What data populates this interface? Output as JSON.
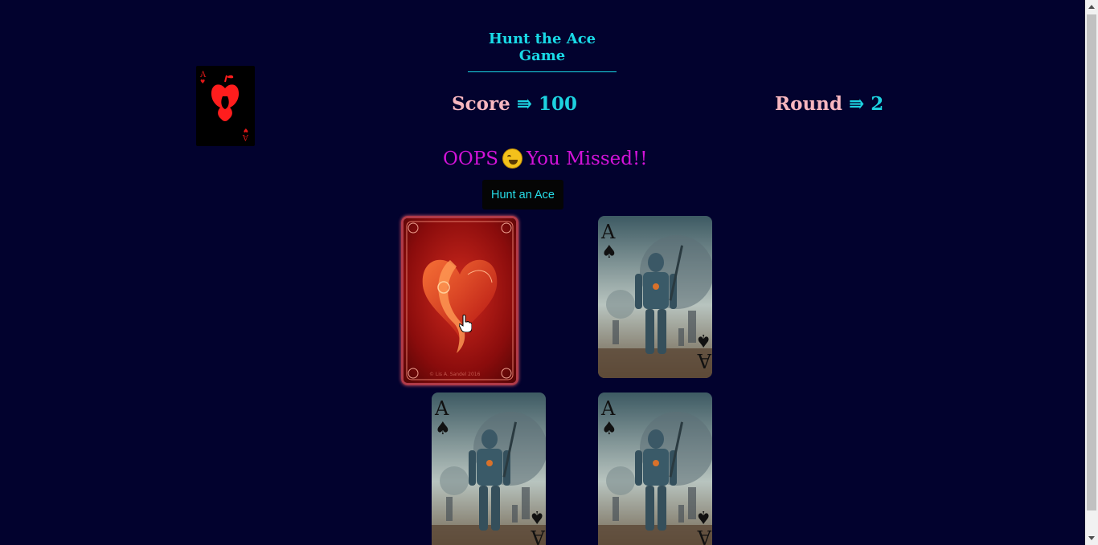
{
  "game": {
    "title": "Hunt the Ace Game",
    "score_label": "Score",
    "score_arrow": "⇛",
    "score_value": "100",
    "round_label": "Round",
    "round_arrow": "⇛",
    "round_value": "2",
    "message_before": "OOPS",
    "message_emoji": "rolling-on-floor-laughing-emoji",
    "message_after": "You Missed!!",
    "hunt_button_label": "Hunt an Ace"
  },
  "logo_card": {
    "rank": "A",
    "suit": "hearts",
    "icon": "apple-core-heart-icon"
  },
  "cards": [
    {
      "state": "flipped",
      "face": "red-heart-back"
    },
    {
      "state": "face-up",
      "rank": "A",
      "suit": "♠",
      "face": "robot-ace-of-spades"
    },
    {
      "state": "face-up",
      "rank": "A",
      "suit": "♠",
      "face": "robot-ace-of-spades"
    },
    {
      "state": "face-up",
      "rank": "A",
      "suit": "♠",
      "face": "robot-ace-of-spades"
    }
  ],
  "colors": {
    "background": "#02022e",
    "accent_cyan": "#1dd2e0",
    "label_pink": "#f7b6bf",
    "message_magenta": "#d313d9"
  }
}
